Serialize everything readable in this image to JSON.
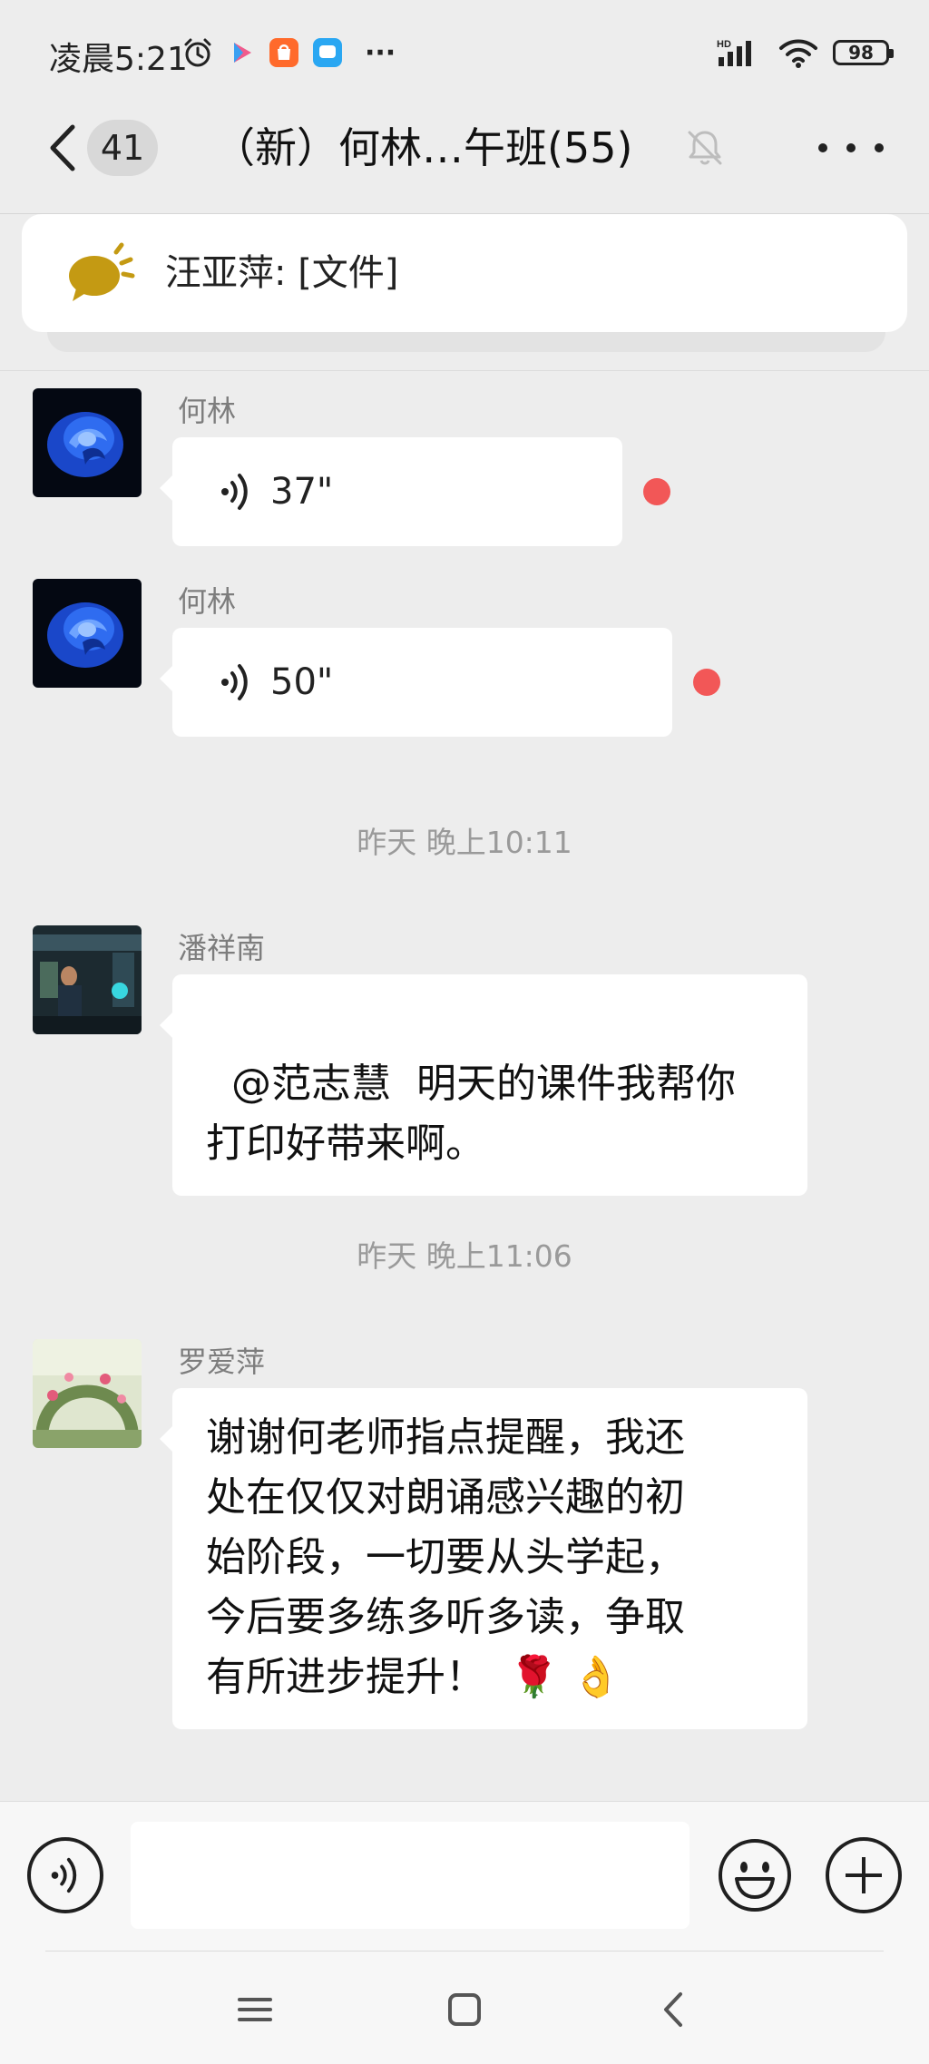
{
  "status_bar": {
    "time": "凌晨5:21",
    "network_label": "HD",
    "battery": "98",
    "more_indicator": "···"
  },
  "header": {
    "unread_count": "41",
    "title": "（新）何林…午班(55)",
    "icons": [
      "back-icon",
      "mute-bell-icon",
      "more-icon"
    ]
  },
  "pinned": {
    "text": "汪亚萍: [文件]",
    "icon": "announcement-icon"
  },
  "messages": [
    {
      "type": "voice",
      "sender": "何林",
      "duration": "37\"",
      "unread": true
    },
    {
      "type": "voice",
      "sender": "何林",
      "duration": "50\"",
      "unread": true
    },
    {
      "type": "time",
      "text": "昨天 晚上10:11"
    },
    {
      "type": "text",
      "sender": "潘祥南",
      "text": "@范志慧  明天的课件我帮你\n打印好带来啊。"
    },
    {
      "type": "time",
      "text": "昨天 晚上11:06"
    },
    {
      "type": "text",
      "sender": "罗爱萍",
      "text": "谢谢何老师指点提醒，我还\n处在仅仅对朗诵感兴趣的初\n始阶段，一切要从头学起，\n今后要多练多听多读，争取\n有所进步提升！",
      "emoji": [
        "🌹",
        "👌"
      ]
    }
  ],
  "input_bar": {
    "icons": [
      "voice-input-icon",
      "emoji-icon",
      "plus-icon"
    ]
  },
  "nav_bar": {
    "icons": [
      "menu-icon",
      "home-icon",
      "back-nav-icon"
    ]
  },
  "colors": {
    "background": "#ededed",
    "bubble": "#ffffff",
    "unread_dot": "#f25757",
    "announcement": "#c49a13"
  }
}
